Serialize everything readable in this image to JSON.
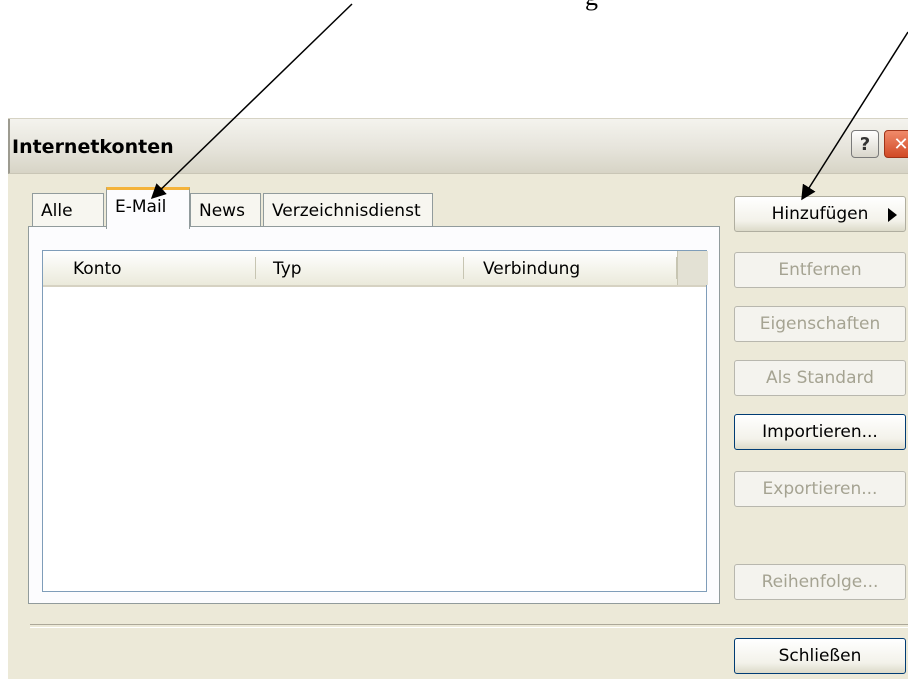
{
  "caption": "g",
  "window": {
    "title": "Internetkonten",
    "help_label": "?",
    "close_label": "✕"
  },
  "tabs": [
    {
      "label": "Alle",
      "active": false
    },
    {
      "label": "E-Mail",
      "active": true
    },
    {
      "label": "News",
      "active": false
    },
    {
      "label": "Verzeichnisdienst",
      "active": false
    }
  ],
  "list": {
    "columns": [
      "Konto",
      "Typ",
      "Verbindung"
    ],
    "rows": []
  },
  "buttons": {
    "add": "Hinzufügen",
    "remove": "Entfernen",
    "properties": "Eigenschaften",
    "set_default": "Als Standard",
    "import": "Importieren...",
    "export": "Exportieren...",
    "order": "Reihenfolge...",
    "close": "Schließen"
  },
  "button_states": {
    "add": "enabled",
    "remove": "disabled",
    "properties": "disabled",
    "set_default": "disabled",
    "import": "enabled",
    "export": "disabled",
    "order": "disabled",
    "close": "enabled"
  }
}
